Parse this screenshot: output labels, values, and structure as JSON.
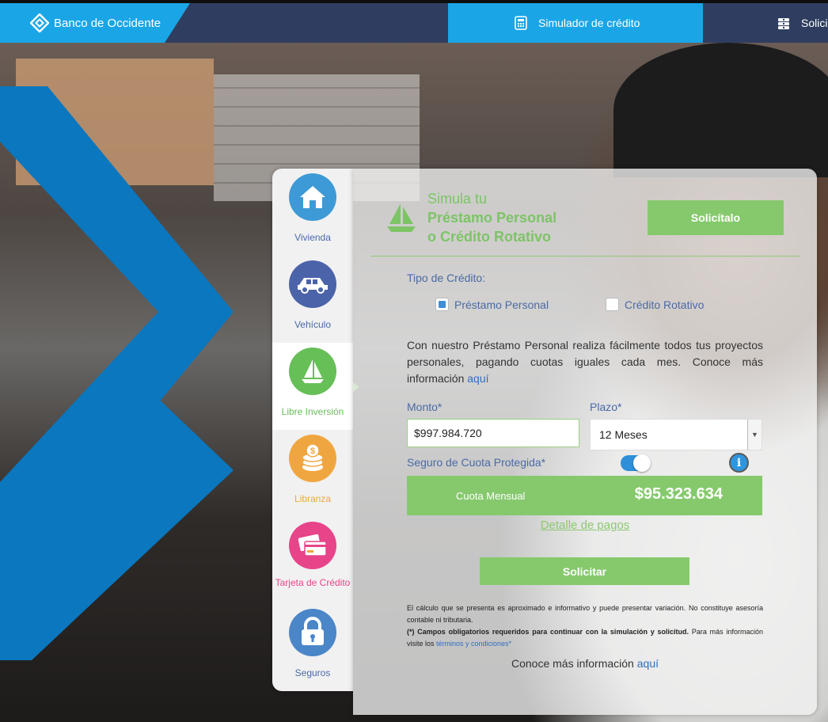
{
  "header": {
    "logo_text": "Banco de Occidente",
    "tabs": [
      {
        "label": "Simulador de crédito",
        "icon": "calculator-icon",
        "active": true
      },
      {
        "label": "Solici",
        "icon": "cash-stack-icon",
        "active": false
      }
    ]
  },
  "sidebar": {
    "items": [
      {
        "label": "Vivienda",
        "icon": "house-icon",
        "color": "#3d9ad6"
      },
      {
        "label": "Vehículo",
        "icon": "car-icon",
        "color": "#4b63a8"
      },
      {
        "label": "Libre Inversión",
        "icon": "sailboat-icon",
        "color": "#66bf57",
        "active": true
      },
      {
        "label": "Libranza",
        "icon": "coins-icon",
        "color": "#f0a640"
      },
      {
        "label": "Tarjeta de Crédito",
        "icon": "credit-card-icon",
        "color": "#e7448a"
      },
      {
        "label": "Seguros",
        "icon": "padlock-icon",
        "color": "#4a86c8"
      }
    ]
  },
  "main": {
    "title_line1": "Simula tu",
    "title_line2": "Préstamo Personal",
    "title_line3": "o Crédito Rotativo",
    "top_button": "Solicítalo",
    "tipo_label": "Tipo de Crédito:",
    "options": [
      {
        "label": "Préstamo Personal",
        "checked": true
      },
      {
        "label": "Crédito Rotativo",
        "checked": false
      }
    ],
    "description": "Con nuestro Préstamo Personal realiza fácilmente todos tus proyectos personales, pagando cuotas iguales cada mes. Conoce más información ",
    "description_link": "aquí",
    "monto_label": "Monto*",
    "monto_value": "$997.984.720",
    "plazo_label": "Plazo*",
    "plazo_value": "12 Meses",
    "seguro_label": "Seguro de Cuota Protegida*",
    "seguro_on": true,
    "info_symbol": "i",
    "cuota_label": "Cuota Mensual",
    "cuota_value": "$95.323.634",
    "detalle_link": "Detalle de pagos",
    "solicitar_button": "Solicitar",
    "legal_text": "El cálculo que se presenta es aproximado e informativo y puede presentar variación. No constituye asesoría contable ni tributaria.",
    "legal_bold": "(*) Campos obligatorios requeridos para continuar con la simulación y solicitud.",
    "legal_more": " Para más información visite los ",
    "legal_link": "términos y condiciones",
    "legal_end": "*",
    "conoce_text": "Conoce más información ",
    "conoce_link": "aquí"
  },
  "colors": {
    "brand_blue": "#1aa6e6",
    "header_navy": "#2f3e60",
    "accent_green": "#86c96d"
  }
}
